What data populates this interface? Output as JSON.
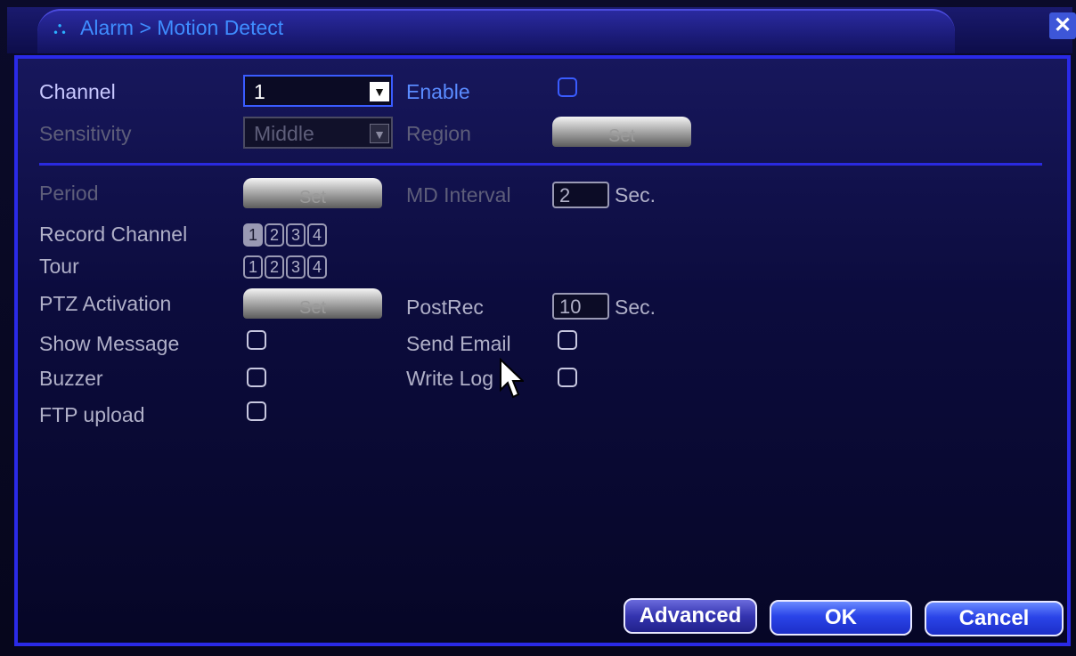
{
  "window": {
    "title": "Alarm > Motion Detect",
    "close_symbol": "✕"
  },
  "channel": {
    "label": "Channel",
    "value": "1"
  },
  "enable": {
    "label": "Enable",
    "checked": false
  },
  "sensitivity": {
    "label": "Sensitivity",
    "value": "Middle"
  },
  "region": {
    "label": "Region",
    "button": "Set"
  },
  "period": {
    "label": "Period",
    "button": "Set"
  },
  "md_interval": {
    "label": "MD Interval",
    "value": "2",
    "unit": "Sec."
  },
  "record_channel": {
    "label": "Record Channel",
    "channels": [
      "1",
      "2",
      "3",
      "4"
    ],
    "selected": [
      "1"
    ]
  },
  "tour": {
    "label": "Tour",
    "channels": [
      "1",
      "2",
      "3",
      "4"
    ]
  },
  "ptz": {
    "label": "PTZ Activation",
    "button": "Set"
  },
  "postrec": {
    "label": "PostRec",
    "value": "10",
    "unit": "Sec."
  },
  "show_message": {
    "label": "Show Message",
    "checked": false
  },
  "send_email": {
    "label": "Send Email",
    "checked": false
  },
  "buzzer": {
    "label": "Buzzer",
    "checked": false
  },
  "write_log": {
    "label": "Write Log",
    "checked": false
  },
  "ftp_upload": {
    "label": "FTP upload",
    "checked": false
  },
  "buttons": {
    "advanced": "Advanced",
    "ok": "OK",
    "cancel": "Cancel"
  },
  "colors": {
    "panel": "#0c0c3e",
    "accent": "#2a2ae8",
    "active_label": "#c8c8ff"
  }
}
